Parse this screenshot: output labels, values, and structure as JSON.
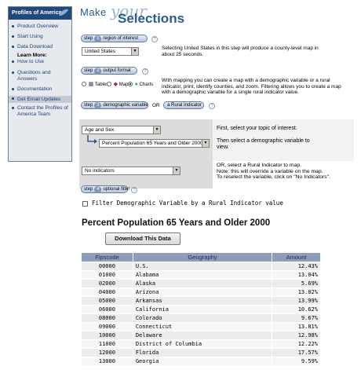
{
  "sidebar": {
    "title": "Profiles of America",
    "items": [
      {
        "label": "Product Overview"
      },
      {
        "label": "Start Using"
      },
      {
        "label": "Data Download"
      },
      {
        "label": "Learn More:"
      },
      {
        "label": "How to Use"
      },
      {
        "label": "Questions and Answers"
      },
      {
        "label": "Documentation"
      },
      {
        "label": "Get Email Updates"
      },
      {
        "label": "Contact the Profiles of America Team"
      }
    ]
  },
  "header": {
    "make": "Make",
    "your": "your",
    "selections": "Selections"
  },
  "steps": {
    "step_label": "step",
    "s1": {
      "num": "1",
      "label": "region of interest",
      "help": "?"
    },
    "s2": {
      "num": "2",
      "label": "output format",
      "help": "?"
    },
    "s3": {
      "num": "3",
      "label": "demographic variable",
      "or": "OR",
      "rural": "a Rural Indicator",
      "help": "?"
    },
    "s4": {
      "num": "4",
      "label": "optional filter",
      "help": "?"
    }
  },
  "region": {
    "selected": "United States",
    "note": "Selecting United States in this step will produce a county-level map in about  25 seconds."
  },
  "output": {
    "options": [
      {
        "label": "Tables"
      },
      {
        "label": "Maps"
      },
      {
        "label": "Charts"
      }
    ],
    "note": "With mapping you can create a map with a demographic variable or a rural indicator, print, identify counties, and zoom. Filtering allows you to create a map with a demographic variable for a single rural indicator value."
  },
  "demographic": {
    "topic": "Age and Sex",
    "variable": "Percent Population 65 Years and Older 2000",
    "instr1": "First, select your topic of interest.",
    "instr2": "Then select a demographic variable to view."
  },
  "rural": {
    "selected": "No indicators",
    "instr": "OR, select a Rural Indicator to map.\nNote: this will override a variable on the map.\nTo reselect the variable, click on \"No Indicators\"."
  },
  "filter": {
    "label": "Filter Demographic Variable by a Rural Indicator value"
  },
  "results": {
    "title": "Percent Population 65 Years and Older 2000",
    "download_label": "Download This Data",
    "columns": [
      "Fipscode",
      "Geography",
      "Amount"
    ],
    "rows": [
      [
        "00000",
        "U.S.",
        "12.43%"
      ],
      [
        "01000",
        "Alabama",
        "13.04%"
      ],
      [
        "02000",
        "Alaska",
        "5.69%"
      ],
      [
        "04000",
        "Arizona",
        "13.02%"
      ],
      [
        "05000",
        "Arkansas",
        "13.99%"
      ],
      [
        "06000",
        "California",
        "10.62%"
      ],
      [
        "08000",
        "Colorado",
        "9.67%"
      ],
      [
        "09000",
        "Connecticut",
        "13.81%"
      ],
      [
        "10000",
        "Delaware",
        "12.98%"
      ],
      [
        "11000",
        "District of Columbia",
        "12.22%"
      ],
      [
        "12000",
        "Florida",
        "17.57%"
      ],
      [
        "13000",
        "Georgia",
        "9.59%"
      ]
    ]
  }
}
